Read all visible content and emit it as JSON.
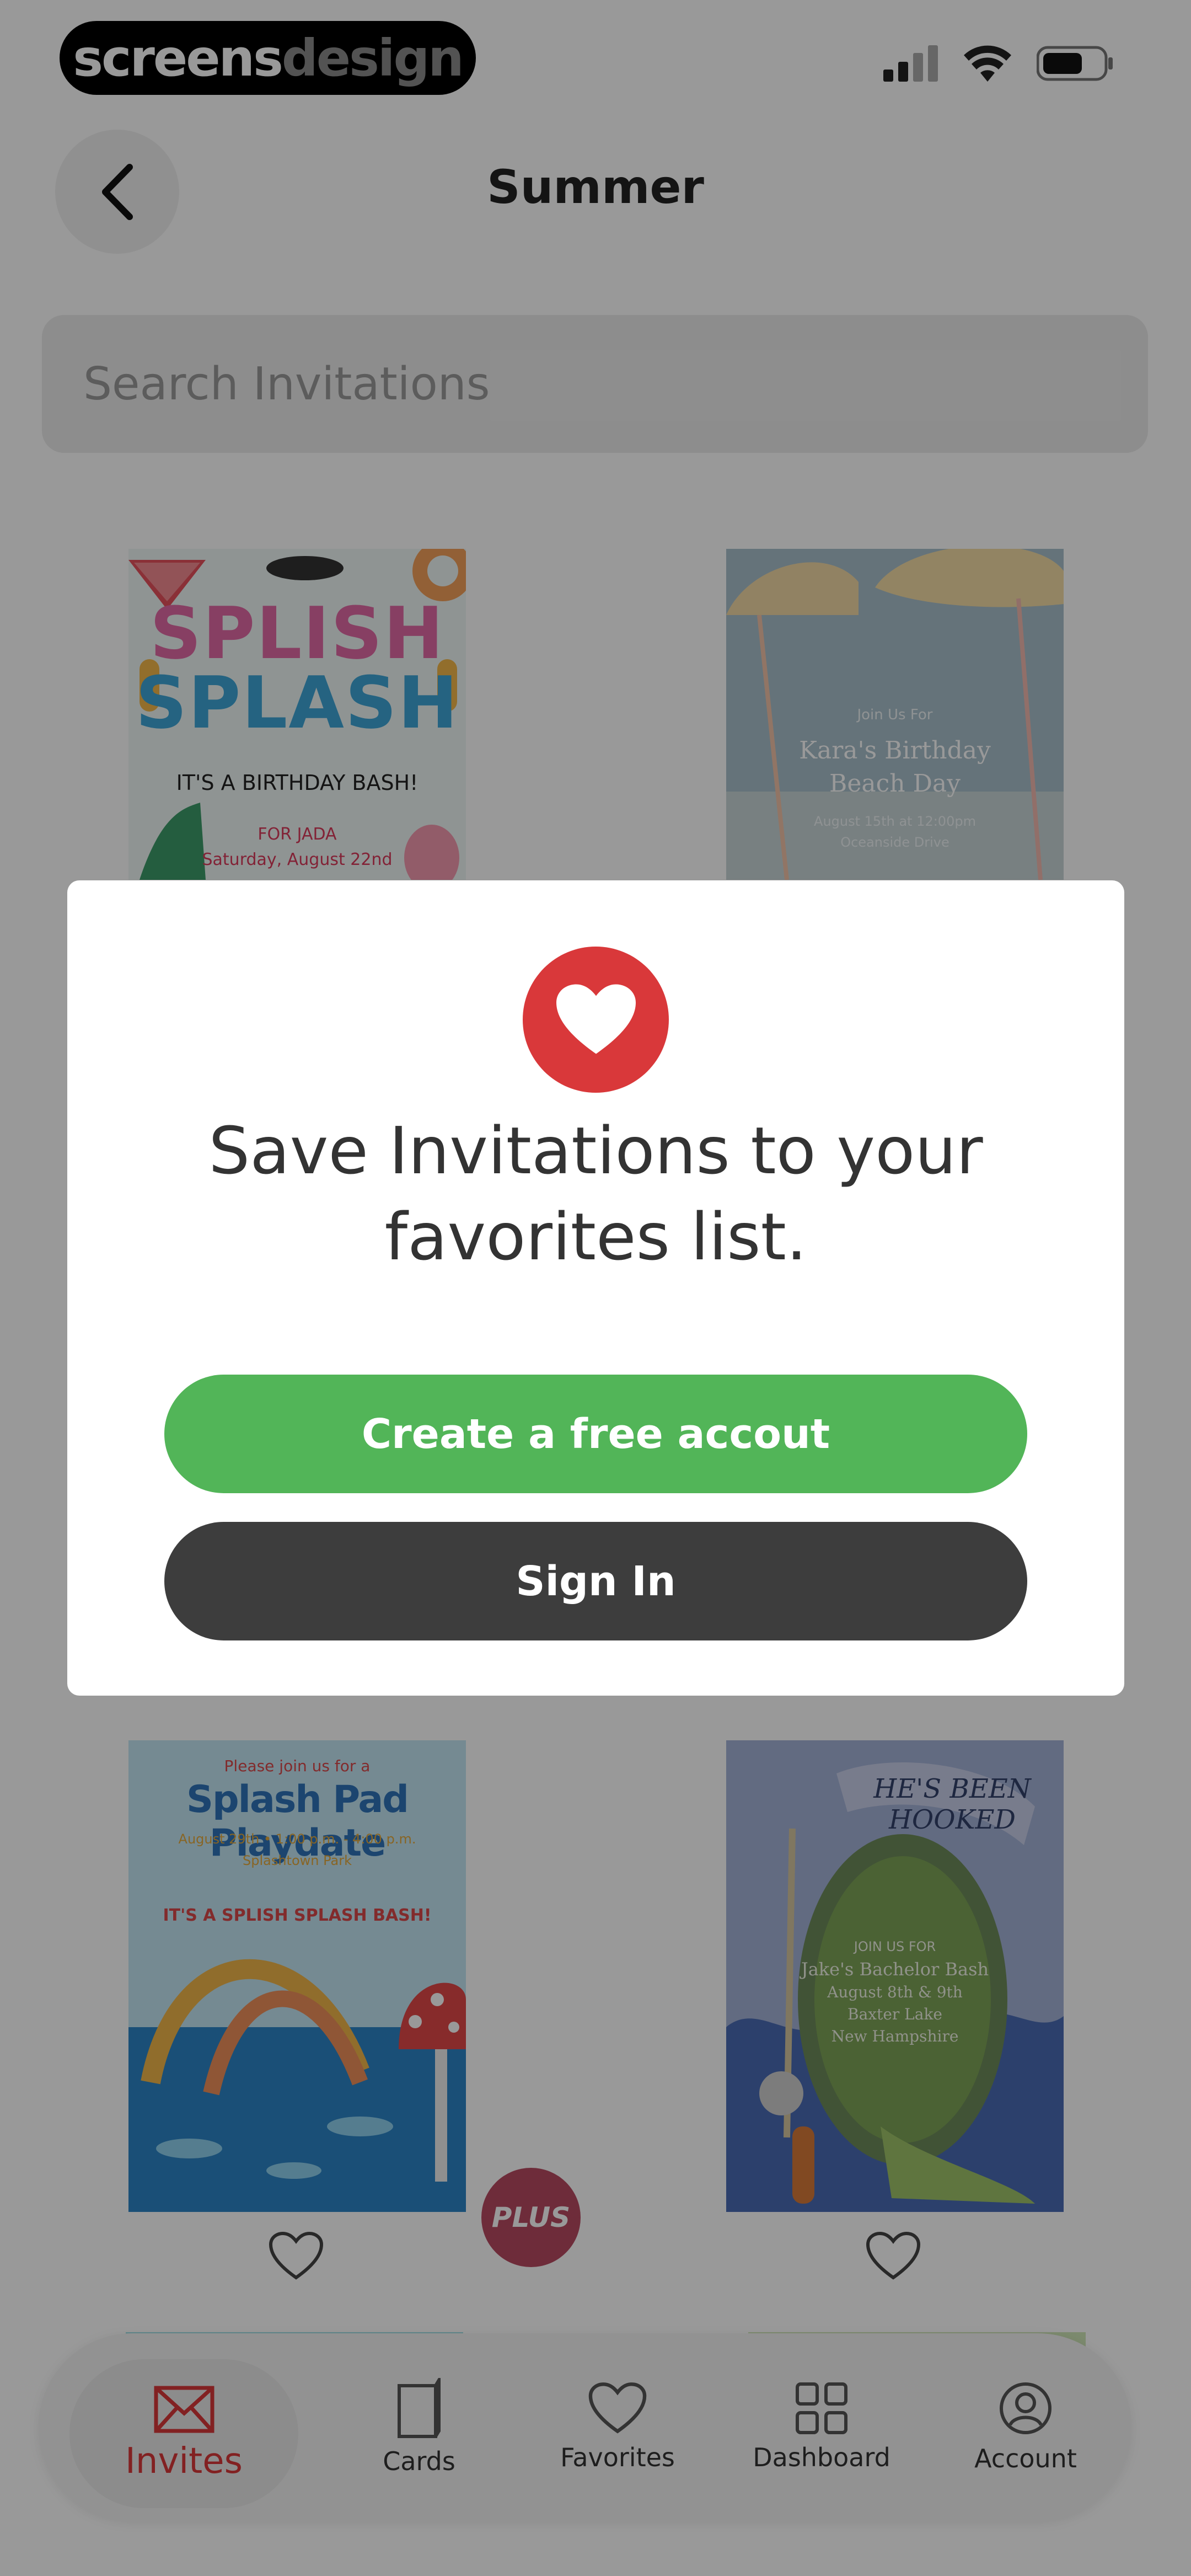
{
  "brand": {
    "part1": "screens",
    "part2": "design"
  },
  "header": {
    "title": "Summer"
  },
  "search": {
    "placeholder": "Search Invitations"
  },
  "cards": [
    {
      "lines": [
        "SPLISH",
        "SPLASH",
        "IT'S A BIRTHDAY BASH!",
        "FOR JADA",
        "Saturday, August 22nd"
      ]
    },
    {
      "lines": [
        "Join Us For",
        "Kara's Birthday",
        "Beach Day",
        "August 15th at 12:00pm",
        "Oceanside Drive"
      ]
    },
    {
      "lines": [
        "Please join us for a",
        "Splash Pad Playdate",
        "August 29th • 1:00 p.m. - 4:00 p.m.",
        "Splashtown Park",
        "IT'S A SPLISH SPLASH BASH!"
      ]
    },
    {
      "lines": [
        "HE'S BEEN HOOKED",
        "JOIN US FOR",
        "Jake's Bachelor Bash",
        "August 8th & 9th",
        "Baxter Lake",
        "New Hampshire"
      ]
    }
  ],
  "plus_badge": "PLUS",
  "modal": {
    "message": "Save Invitations to your favorites list.",
    "create_label": "Create a free accout",
    "signin_label": "Sign In"
  },
  "tabs": [
    {
      "label": "Invites",
      "icon": "envelope-icon",
      "active": true
    },
    {
      "label": "Cards",
      "icon": "card-icon"
    },
    {
      "label": "Favorites",
      "icon": "heart-icon"
    },
    {
      "label": "Dashboard",
      "icon": "grid-icon"
    },
    {
      "label": "Account",
      "icon": "user-icon"
    }
  ],
  "colors": {
    "accent_red": "#d9383a",
    "create_green": "#52b558",
    "signin_dark": "#3d3d3d"
  }
}
